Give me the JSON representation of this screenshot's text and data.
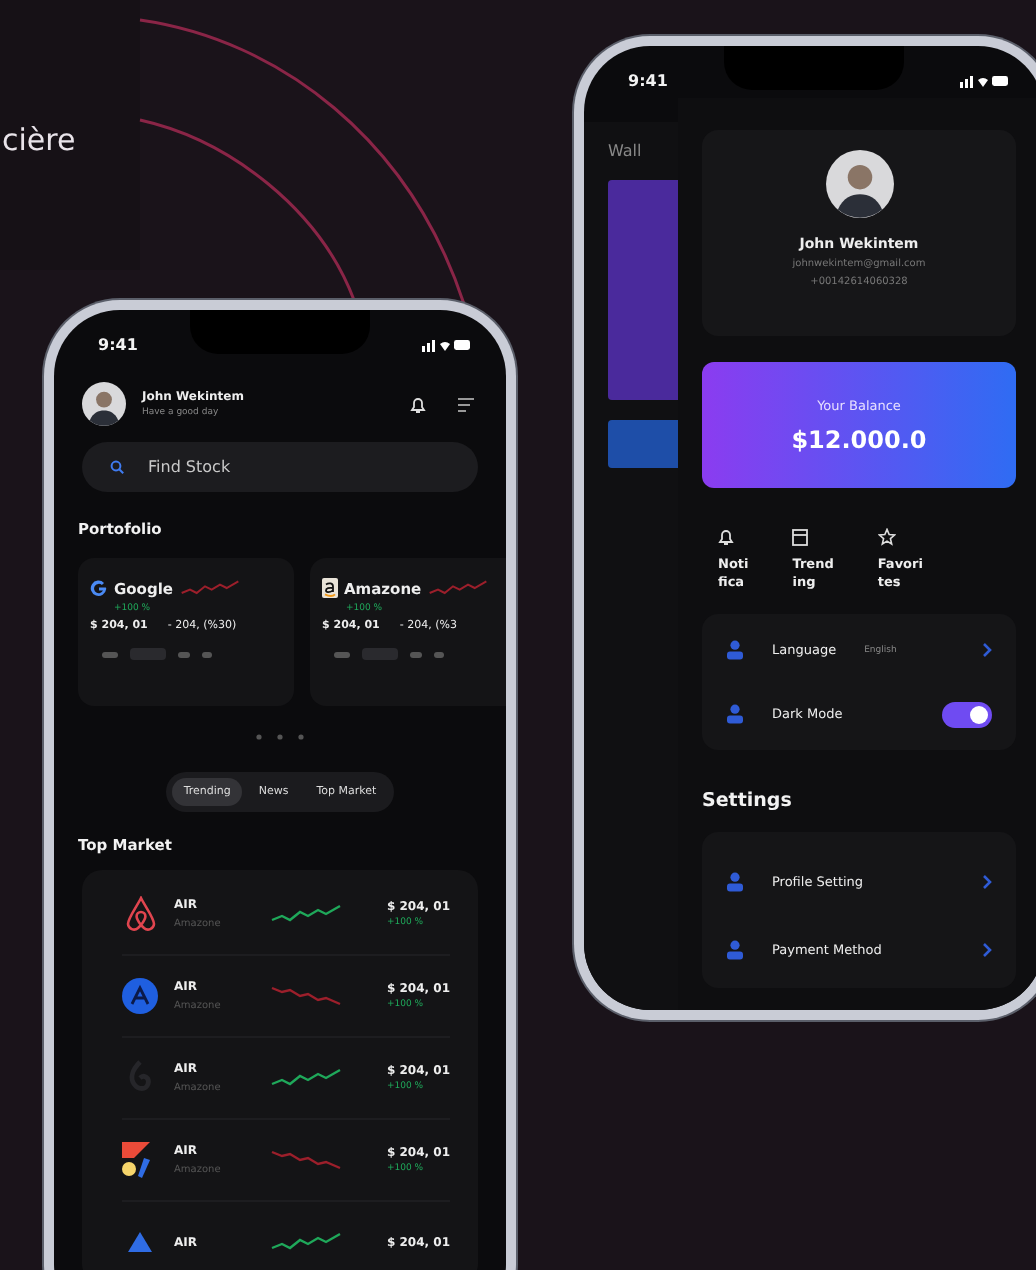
{
  "slide_caption": "cière",
  "market_phone": {
    "status_time": "9:41",
    "user": {
      "name": "John Wekintem",
      "greeting": "Have a good day"
    },
    "search": {
      "placeholder": "Find Stock"
    },
    "portfolio_title": "Portofolio",
    "portfolio": [
      {
        "name": "Google",
        "change": "+100 %",
        "price": "$ 204, 01",
        "delta": "- 204, (%30)"
      },
      {
        "name": "Amazone",
        "change": "+100 %",
        "price": "$ 204, 01",
        "delta": "- 204, (%3"
      }
    ],
    "tabs": [
      {
        "label": "Trending",
        "selected": true
      },
      {
        "label": "News",
        "selected": false
      },
      {
        "label": "Top Market",
        "selected": false
      }
    ],
    "top_market_title": "Top Market",
    "top_market": [
      {
        "symbol": "AIR",
        "company": "Amazone",
        "color": "#1fa85a",
        "price": "$ 204, 01",
        "change": "+100 %"
      },
      {
        "symbol": "AIR",
        "company": "Amazone",
        "color": "#9c1f2b",
        "price": "$ 204, 01",
        "change": "+100 %"
      },
      {
        "symbol": "AIR",
        "company": "Amazone",
        "color": "#1fa85a",
        "price": "$ 204, 01",
        "change": "+100 %"
      },
      {
        "symbol": "AIR",
        "company": "Amazone",
        "color": "#9c1f2b",
        "price": "$ 204, 01",
        "change": "+100 %"
      },
      {
        "symbol": "AIR",
        "color": "#1fa85a",
        "price": "$ 204, 01"
      }
    ]
  },
  "profile_phone": {
    "status_time": "9:41",
    "behind_title": "Wall",
    "profile": {
      "name": "John Wekintem",
      "email": "johnwekintem@gmail.com",
      "phone": "+00142614060328"
    },
    "balance": {
      "label": "Your Balance",
      "amount": "$12.000.0"
    },
    "shortcuts": [
      {
        "label_lines": [
          "Noti",
          "fica"
        ]
      },
      {
        "label_lines": [
          "Trend",
          "ing"
        ]
      },
      {
        "label_lines": [
          "Favori",
          "tes"
        ]
      }
    ],
    "preferences": [
      {
        "kind": "link",
        "label": "Language",
        "value": "English"
      },
      {
        "kind": "toggle",
        "label": "Dark Mode",
        "on": true
      }
    ],
    "settings_title": "Settings",
    "settings": [
      {
        "label": "Profile Setting"
      },
      {
        "label": "Payment Method"
      }
    ]
  }
}
